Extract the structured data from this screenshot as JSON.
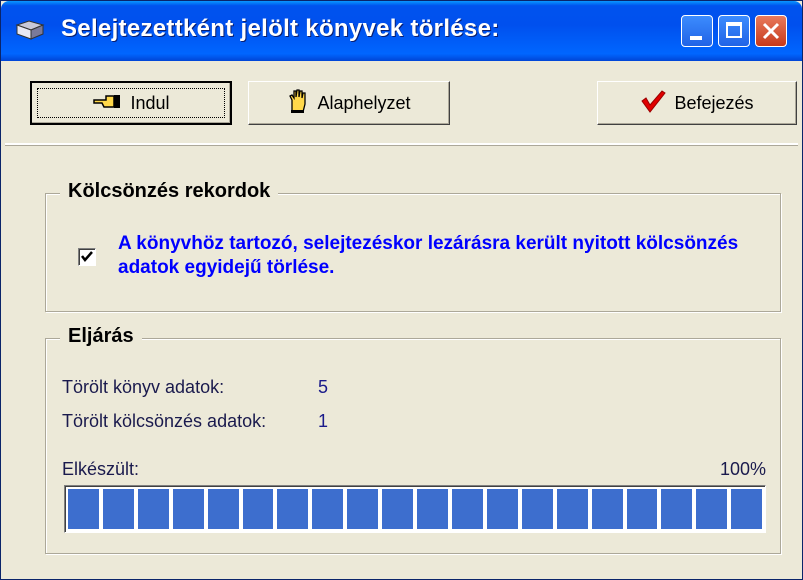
{
  "window": {
    "title": "Selejtezettként jelölt könyvek törlése:"
  },
  "toolbar": {
    "start_label": "Indul",
    "reset_label": "Alaphelyzet",
    "finish_label": "Befejezés"
  },
  "loans_group": {
    "title": "Kölcsönzés rekordok",
    "checkbox_checked": true,
    "checkbox_label": "A könyvhöz tartozó, selejtezéskor lezárásra került nyitott kölcsönzés adatok egyidejű törlése."
  },
  "procedure_group": {
    "title": "Eljárás",
    "deleted_books_label": "Törölt könyv adatok:",
    "deleted_books_value": "5",
    "deleted_loans_label": "Törölt kölcsönzés adatok:",
    "deleted_loans_value": "1",
    "progress_label": "Elkészült:",
    "progress_text": "100%",
    "progress_fraction": 1.0
  },
  "colors": {
    "titlebar": "#0053ee",
    "checkbox_label": "#0000ff",
    "progress_fill": "#3d6ece"
  },
  "icons": {
    "title": "book-icon",
    "start": "pointing-hand-icon",
    "reset": "raised-hand-icon",
    "finish": "checkmark-icon"
  }
}
